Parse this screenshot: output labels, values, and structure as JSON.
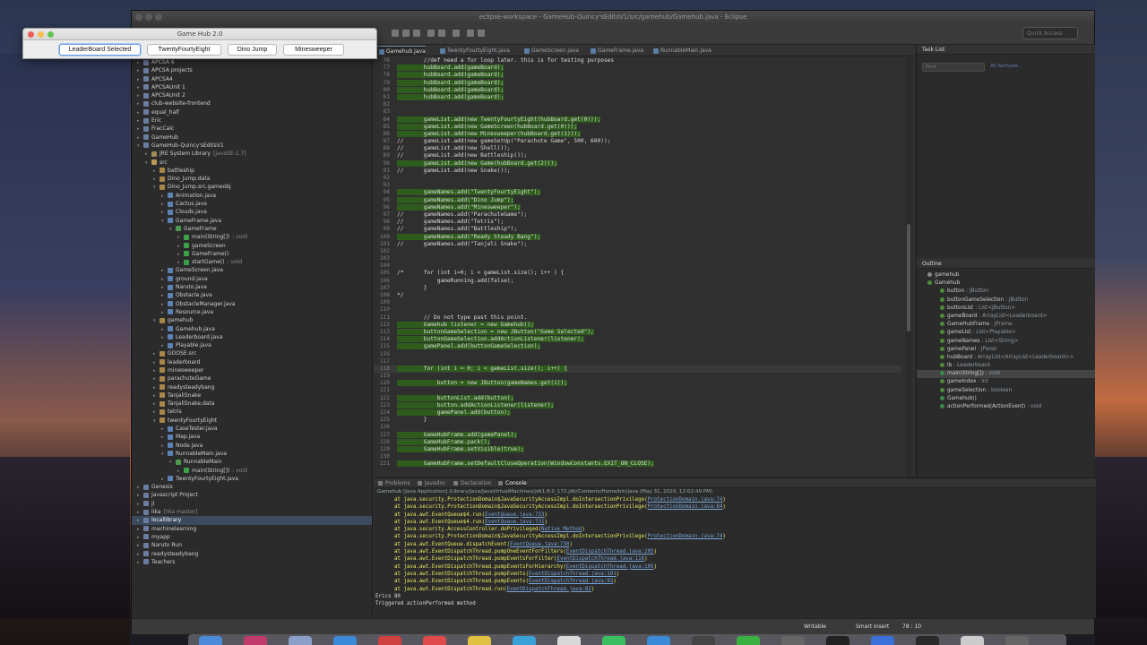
{
  "eclipse": {
    "window_title": "eclipse-workspace - GameHub-Quincy'sEditsV1/src/gamehub/Gamehub.java - Eclipse",
    "quick_access_placeholder": "Quick Access"
  },
  "gamehub_window": {
    "title": "Game Hub 2.0",
    "buttons": [
      "LeaderBoard Selected",
      "TwentyFourtyEight",
      "Dino Jump",
      "Minesweeper"
    ]
  },
  "explorer": {
    "rows": [
      {
        "label": "APCSA 6",
        "indent": 0,
        "icon": "project-icon"
      },
      {
        "label": "APCSA projects",
        "indent": 0,
        "icon": "project-icon"
      },
      {
        "label": "APCSA4",
        "indent": 0,
        "icon": "project-icon"
      },
      {
        "label": "APCSAUnit 1",
        "indent": 0,
        "icon": "project-icon"
      },
      {
        "label": "APCSAUnit 2",
        "indent": 0,
        "icon": "project-icon"
      },
      {
        "label": "club-website-frontend",
        "indent": 0,
        "icon": "project-icon"
      },
      {
        "label": "equal_half",
        "indent": 0,
        "icon": "project-icon"
      },
      {
        "label": "Eric",
        "indent": 0,
        "icon": "project-icon"
      },
      {
        "label": "FracCalc",
        "indent": 0,
        "icon": "project-icon"
      },
      {
        "label": "GameHub",
        "indent": 0,
        "icon": "project-icon"
      },
      {
        "label": "GameHub-Quincy'sEditsV1",
        "indent": 0,
        "icon": "project-icon",
        "open": true
      },
      {
        "label": "JRE System Library",
        "suffix": "[JavaSE-1.7]",
        "indent": 1,
        "icon": "library-icon"
      },
      {
        "label": "src",
        "indent": 1,
        "icon": "folder-icon",
        "open": true
      },
      {
        "label": "battleship",
        "indent": 2,
        "icon": "package-icon"
      },
      {
        "label": "Dino_Jump.data",
        "indent": 2,
        "icon": "package-icon"
      },
      {
        "label": "Dino_Jump.src.gameobj",
        "indent": 2,
        "icon": "package-icon",
        "open": true
      },
      {
        "label": "Animation.java",
        "indent": 3,
        "icon": "java-file-icon"
      },
      {
        "label": "Cactus.java",
        "indent": 3,
        "icon": "java-file-icon"
      },
      {
        "label": "Clouds.java",
        "indent": 3,
        "icon": "java-file-icon"
      },
      {
        "label": "GameFrame.java",
        "indent": 3,
        "icon": "java-file-icon",
        "open": true
      },
      {
        "label": "GameFrame",
        "indent": 4,
        "icon": "class-icon",
        "open": true
      },
      {
        "label": "main(String[])",
        "suffix": ": void",
        "indent": 5,
        "icon": "method-icon"
      },
      {
        "label": "gameScreen",
        "indent": 5,
        "icon": "field-icon"
      },
      {
        "label": "GameFrame()",
        "indent": 5,
        "icon": "method-icon"
      },
      {
        "label": "startGame()",
        "suffix": ": void",
        "indent": 5,
        "icon": "method-icon"
      },
      {
        "label": "GameScreen.java",
        "indent": 3,
        "icon": "java-file-icon"
      },
      {
        "label": "ground.java",
        "indent": 3,
        "icon": "java-file-icon"
      },
      {
        "label": "Naruto.java",
        "indent": 3,
        "icon": "java-file-icon"
      },
      {
        "label": "Obstacle.java",
        "indent": 3,
        "icon": "java-file-icon"
      },
      {
        "label": "ObstacleManager.java",
        "indent": 3,
        "icon": "java-file-icon"
      },
      {
        "label": "Resource.java",
        "indent": 3,
        "icon": "java-file-icon"
      },
      {
        "label": "gamehub",
        "indent": 2,
        "icon": "package-icon",
        "open": true
      },
      {
        "label": "Gamehub.java",
        "indent": 3,
        "icon": "java-file-icon"
      },
      {
        "label": "Leaderboard.java",
        "indent": 3,
        "icon": "java-file-icon"
      },
      {
        "label": "Playable.java",
        "indent": 3,
        "icon": "java-file-icon"
      },
      {
        "label": "GOOSE.src",
        "indent": 2,
        "icon": "package-icon"
      },
      {
        "label": "leaderboard",
        "indent": 2,
        "icon": "package-icon"
      },
      {
        "label": "minesweeper",
        "indent": 2,
        "icon": "package-icon"
      },
      {
        "label": "parachuteGame",
        "indent": 2,
        "icon": "package-icon"
      },
      {
        "label": "readysteadybang",
        "indent": 2,
        "icon": "package-icon"
      },
      {
        "label": "TanjaliSnake",
        "indent": 2,
        "icon": "package-icon"
      },
      {
        "label": "TanjaliSnake.data",
        "indent": 2,
        "icon": "package-icon"
      },
      {
        "label": "tetris",
        "indent": 2,
        "icon": "package-icon"
      },
      {
        "label": "twentyFourtyEight",
        "indent": 2,
        "icon": "package-icon",
        "open": true
      },
      {
        "label": "CaseTester.java",
        "indent": 3,
        "icon": "java-file-icon"
      },
      {
        "label": "Map.java",
        "indent": 3,
        "icon": "java-file-icon"
      },
      {
        "label": "Node.java",
        "indent": 3,
        "icon": "java-file-icon"
      },
      {
        "label": "RunnableMain.java",
        "indent": 3,
        "icon": "java-file-icon",
        "open": true
      },
      {
        "label": "RunnableMain",
        "indent": 4,
        "icon": "class-icon",
        "open": true
      },
      {
        "label": "main(String[])",
        "suffix": ": void",
        "indent": 5,
        "icon": "method-icon"
      },
      {
        "label": "TwentyFourtyEight.java",
        "indent": 3,
        "icon": "java-file-icon"
      },
      {
        "label": "Genesis",
        "indent": 0,
        "icon": "project-icon"
      },
      {
        "label": "Javascript Project",
        "indent": 0,
        "icon": "project-icon"
      },
      {
        "label": "jl",
        "indent": 0,
        "icon": "project-icon"
      },
      {
        "label": "lika",
        "suffix": "[lika master]",
        "indent": 0,
        "icon": "project-icon"
      },
      {
        "label": "locallibrary",
        "indent": 0,
        "icon": "project-icon",
        "selected": true
      },
      {
        "label": "machinelearning",
        "indent": 0,
        "icon": "project-icon"
      },
      {
        "label": "myapp",
        "indent": 0,
        "icon": "project-icon"
      },
      {
        "label": "Naruto Run",
        "indent": 0,
        "icon": "project-icon"
      },
      {
        "label": "readysteadybang",
        "indent": 0,
        "icon": "project-icon"
      },
      {
        "label": "Teachers",
        "indent": 0,
        "icon": "project-icon"
      }
    ]
  },
  "editor": {
    "tabs": [
      "Gamehub.java",
      "TwentyFourtyEight.java",
      "GameScreen.java",
      "GameFrame.java",
      "RunnableMain.java"
    ],
    "active_tab": 0,
    "lines": [
      {
        "n": "76",
        "t": "        //def need a for loop later. this is for testing purposes",
        "hl": false
      },
      {
        "n": "77",
        "t": "        hubBoard.add(gameBoard);",
        "hl": true
      },
      {
        "n": "78",
        "t": "        hubBoard.add(gameBoard);",
        "hl": true
      },
      {
        "n": "79",
        "t": "        hubBoard.add(gameBoard);",
        "hl": true
      },
      {
        "n": "80",
        "t": "        hubBoard.add(gameBoard);",
        "hl": true
      },
      {
        "n": "81",
        "t": "        hubBoard.add(gameBoard);",
        "hl": true
      },
      {
        "n": "82",
        "t": "",
        "hl": false
      },
      {
        "n": "83",
        "t": "",
        "hl": false
      },
      {
        "n": "84",
        "t": "        gameList.add(new TwentyFourtyEight(hubBoard.get(0)));",
        "hl": true
      },
      {
        "n": "85",
        "t": "        gameList.add(new GameScreen(hubBoard.get(0)));",
        "hl": true
      },
      {
        "n": "86",
        "t": "        gameList.add(new Minesweeper(hubBoard.get(1)));",
        "hl": true
      },
      {
        "n": "87",
        "t": "//      gameList.add(new gameSetUp(\"Parachute Game\", 500, 600));",
        "hl": false
      },
      {
        "n": "88",
        "t": "//      gameList.add(new Shell());",
        "hl": false
      },
      {
        "n": "89",
        "t": "//      gameList.add(new Battleship());",
        "hl": false
      },
      {
        "n": "90",
        "t": "        gameList.add(new Game(hubBoard.get(2)));",
        "hl": true
      },
      {
        "n": "91",
        "t": "//      gameList.add(new Snake());",
        "hl": false
      },
      {
        "n": "92",
        "t": "",
        "hl": false
      },
      {
        "n": "93",
        "t": "",
        "hl": false
      },
      {
        "n": "94",
        "t": "        gameNames.add(\"TwentyFourtyEight\");",
        "hl": true
      },
      {
        "n": "95",
        "t": "        gameNames.add(\"Dino Jump\");",
        "hl": true
      },
      {
        "n": "96",
        "t": "        gameNames.add(\"Minesweeper\");",
        "hl": true
      },
      {
        "n": "97",
        "t": "//      gameNames.add(\"ParachuteGame\");",
        "hl": false
      },
      {
        "n": "98",
        "t": "//      gameNames.add(\"Tetris\");",
        "hl": false
      },
      {
        "n": "99",
        "t": "//      gameNames.add(\"Battleship\");",
        "hl": false
      },
      {
        "n": "100",
        "t": "        gameNames.add(\"Ready Steady Bang\");",
        "hl": true
      },
      {
        "n": "101",
        "t": "//      gameNames.add(\"Tanjali Snake\");",
        "hl": false
      },
      {
        "n": "102",
        "t": "",
        "hl": false
      },
      {
        "n": "103",
        "t": "",
        "hl": false
      },
      {
        "n": "104",
        "t": "",
        "hl": false
      },
      {
        "n": "105",
        "t": "/*      for (int i=0; i < gameList.size(); i++ ) {",
        "hl": false
      },
      {
        "n": "106",
        "t": "            gameRunning.add(false);",
        "hl": false
      },
      {
        "n": "107",
        "t": "        }",
        "hl": false
      },
      {
        "n": "108",
        "t": "*/",
        "hl": false
      },
      {
        "n": "109",
        "t": "",
        "hl": false
      },
      {
        "n": "110",
        "t": "",
        "hl": false
      },
      {
        "n": "111",
        "t": "        // Do not type past this point.",
        "hl": false
      },
      {
        "n": "112",
        "t": "        Gamehub listener = new Gamehub();",
        "hl": true
      },
      {
        "n": "113",
        "t": "        buttonGameSelection = new JButton(\"Game Selected\");",
        "hl": true
      },
      {
        "n": "114",
        "t": "        buttonGameSelection.addActionListener(listener);",
        "hl": true
      },
      {
        "n": "115",
        "t": "        gamePanel.add(buttonGameSelection);",
        "hl": true
      },
      {
        "n": "116",
        "t": "",
        "hl": false
      },
      {
        "n": "117",
        "t": "",
        "hl": false
      },
      {
        "n": "118",
        "t": "        for (int i = 0; i < gameList.size(); i++) {",
        "hl": true
      },
      {
        "n": "119",
        "t": "",
        "hl": false
      },
      {
        "n": "120",
        "t": "            button = new JButton(gameNames.get(i));",
        "hl": true
      },
      {
        "n": "121",
        "t": "",
        "hl": false
      },
      {
        "n": "122",
        "t": "            buttonList.add(button);",
        "hl": true
      },
      {
        "n": "123",
        "t": "            button.addActionListener(listener);",
        "hl": true
      },
      {
        "n": "124",
        "t": "            gamePanel.add(button);",
        "hl": true
      },
      {
        "n": "125",
        "t": "        }",
        "hl": false
      },
      {
        "n": "126",
        "t": "",
        "hl": false
      },
      {
        "n": "127",
        "t": "        GameHubFrame.add(gamePanel);",
        "hl": true
      },
      {
        "n": "128",
        "t": "        GameHubFrame.pack();",
        "hl": true
      },
      {
        "n": "129",
        "t": "        GameHubFrame.setVisible(true);",
        "hl": true
      },
      {
        "n": "130",
        "t": "",
        "hl": false
      },
      {
        "n": "131",
        "t": "        GameHubFrame.setDefaultCloseOperation(WindowConstants.EXIT_ON_CLOSE);",
        "hl": true
      }
    ]
  },
  "tasklist": {
    "title": "Task List",
    "find_placeholder": "Find",
    "links": "All   Activate..."
  },
  "outline": {
    "title": "Outline",
    "rows": [
      {
        "label": "gamehub",
        "type": "",
        "indent": 0,
        "color": "#8a8a8a"
      },
      {
        "label": "Gamehub",
        "type": "",
        "indent": 0,
        "color": "#4e8a3a"
      },
      {
        "label": "button",
        "type": ": JButton",
        "indent": 1,
        "color": "#4e8a3a"
      },
      {
        "label": "buttonGameSelection",
        "type": ": JButton",
        "indent": 1,
        "color": "#4e8a3a"
      },
      {
        "label": "buttonList",
        "type": ": List<JButton>",
        "indent": 1,
        "color": "#4e8a3a"
      },
      {
        "label": "gameBoard",
        "type": ": ArrayList<Leaderboard>",
        "indent": 1,
        "color": "#4e8a3a"
      },
      {
        "label": "GameHubFrame",
        "type": ": JFrame",
        "indent": 1,
        "color": "#4e8a3a"
      },
      {
        "label": "gameList",
        "type": ": List<Playable>",
        "indent": 1,
        "color": "#4e8a3a"
      },
      {
        "label": "gameNames",
        "type": ": List<String>",
        "indent": 1,
        "color": "#4e8a3a"
      },
      {
        "label": "gamePanel",
        "type": ": JPanel",
        "indent": 1,
        "color": "#4e8a3a"
      },
      {
        "label": "hubBoard",
        "type": ": ArrayList<ArrayList<Leaderboard>>",
        "indent": 1,
        "color": "#4e8a3a"
      },
      {
        "label": "lb",
        "type": ": Leaderboard",
        "indent": 1,
        "color": "#4e8a3a"
      },
      {
        "label": "main(String[])",
        "type": ": void",
        "indent": 1,
        "color": "#3a8a4a",
        "selected": true
      },
      {
        "label": "gameIndex",
        "type": ": int",
        "indent": 1,
        "color": "#4e8a3a"
      },
      {
        "label": "gameSelection",
        "type": ": boolean",
        "indent": 1,
        "color": "#4e8a3a"
      },
      {
        "label": "Gamehub()",
        "type": "",
        "indent": 1,
        "color": "#3a8a4a"
      },
      {
        "label": "actionPerformed(ActionEvent)",
        "type": ": void",
        "indent": 1,
        "color": "#3a8a4a"
      }
    ]
  },
  "console": {
    "tabs": [
      "Problems",
      "Javadoc",
      "Declaration",
      "Console"
    ],
    "active_tab": 3,
    "info": "Gamehub [Java Application] /Library/Java/JavaVirtualMachines/jdk1.8.0_172.jdk/Contents/Home/bin/java (May 31, 2020, 12:02:49 PM)",
    "lines": [
      {
        "pre": "      at java.security.ProtectionDomain$JavaSecurityAccessImpl.doIntersectionPrivilege(",
        "link": "ProtectionDomain.java:74",
        "post": ")",
        "err": true
      },
      {
        "pre": "      at java.security.ProtectionDomain$JavaSecurityAccessImpl.doIntersectionPrivilege(",
        "link": "ProtectionDomain.java:84",
        "post": ")",
        "err": true
      },
      {
        "pre": "      at java.awt.EventQueue$4.run(",
        "link": "EventQueue.java:733",
        "post": ")",
        "err": true
      },
      {
        "pre": "      at java.awt.EventQueue$4.run(",
        "link": "EventQueue.java:731",
        "post": ")",
        "err": true
      },
      {
        "pre": "      at java.security.AccessController.doPrivileged(",
        "link": "Native Method",
        "post": ")",
        "err": true
      },
      {
        "pre": "      at java.security.ProtectionDomain$JavaSecurityAccessImpl.doIntersectionPrivilege(",
        "link": "ProtectionDomain.java:74",
        "post": ")",
        "err": true
      },
      {
        "pre": "      at java.awt.EventQueue.dispatchEvent(",
        "link": "EventQueue.java:730",
        "post": ")",
        "err": true
      },
      {
        "pre": "      at java.awt.EventDispatchThread.pumpOneEventForFilters(",
        "link": "EventDispatchThread.java:205",
        "post": ")",
        "err": true
      },
      {
        "pre": "      at java.awt.EventDispatchThread.pumpEventsForFilter(",
        "link": "EventDispatchThread.java:116",
        "post": ")",
        "err": true
      },
      {
        "pre": "      at java.awt.EventDispatchThread.pumpEventsForHierarchy(",
        "link": "EventDispatchThread.java:105",
        "post": ")",
        "err": true
      },
      {
        "pre": "      at java.awt.EventDispatchThread.pumpEvents(",
        "link": "EventDispatchThread.java:101",
        "post": ")",
        "err": true
      },
      {
        "pre": "      at java.awt.EventDispatchThread.pumpEvents(",
        "link": "EventDispatchThread.java:93",
        "post": ")",
        "err": true
      },
      {
        "pre": "      at java.awt.EventDispatchThread.run(",
        "link": "EventDispatchThread.java:82",
        "post": ")",
        "err": true
      },
      {
        "pre": "Erics 80",
        "link": "",
        "post": "",
        "err": false
      },
      {
        "pre": "Triggered actionPerformed method",
        "link": "",
        "post": "",
        "err": false
      }
    ]
  },
  "statusbar": {
    "writable": "Writable",
    "insert_mode": "Smart Insert",
    "position": "78 : 10"
  }
}
